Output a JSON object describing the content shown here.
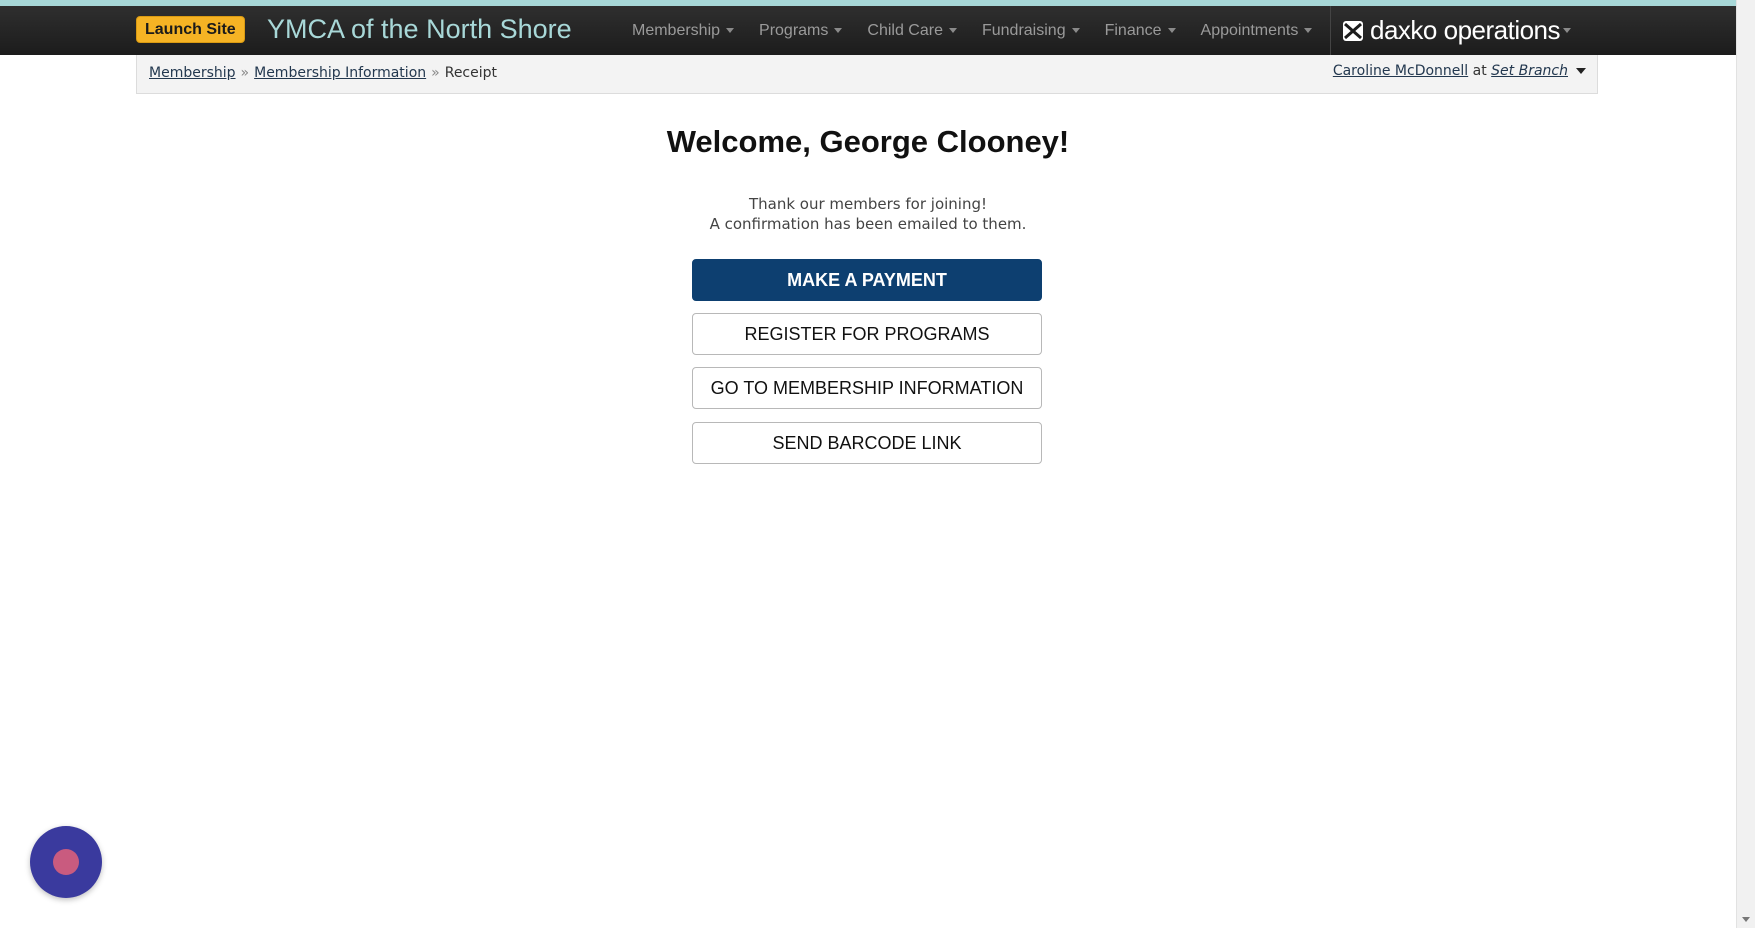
{
  "header": {
    "launch_label": "Launch Site",
    "site_title": "YMCA of the North Shore",
    "menu": [
      {
        "label": "Membership"
      },
      {
        "label": "Programs"
      },
      {
        "label": "Child Care"
      },
      {
        "label": "Fundraising"
      },
      {
        "label": "Finance"
      },
      {
        "label": "Appointments"
      }
    ],
    "brand": "daxko operations",
    "colors": {
      "accent_bar": "#a8d8d8",
      "launch_button": "#f5b324",
      "primary_button": "#0d3f70"
    }
  },
  "breadcrumb": {
    "items": [
      "Membership",
      "Membership Information"
    ],
    "separator": "»",
    "current": "Receipt"
  },
  "user": {
    "name": "Caroline McDonnell",
    "at": "at",
    "branch": "Set Branch"
  },
  "main": {
    "welcome": "Welcome, George Clooney!",
    "message_line1": "Thank our members for joining!",
    "message_line2": "A confirmation has been emailed to them.",
    "buttons": {
      "payment": "MAKE A PAYMENT",
      "programs": "REGISTER FOR PROGRAMS",
      "membership_info": "GO TO MEMBERSHIP INFORMATION",
      "barcode": "SEND BARCODE LINK"
    }
  },
  "icons": {
    "chat": "chat-bubble-icon",
    "brand_logo": "daxko-logo-icon",
    "dropdown": "caret-down-icon"
  }
}
